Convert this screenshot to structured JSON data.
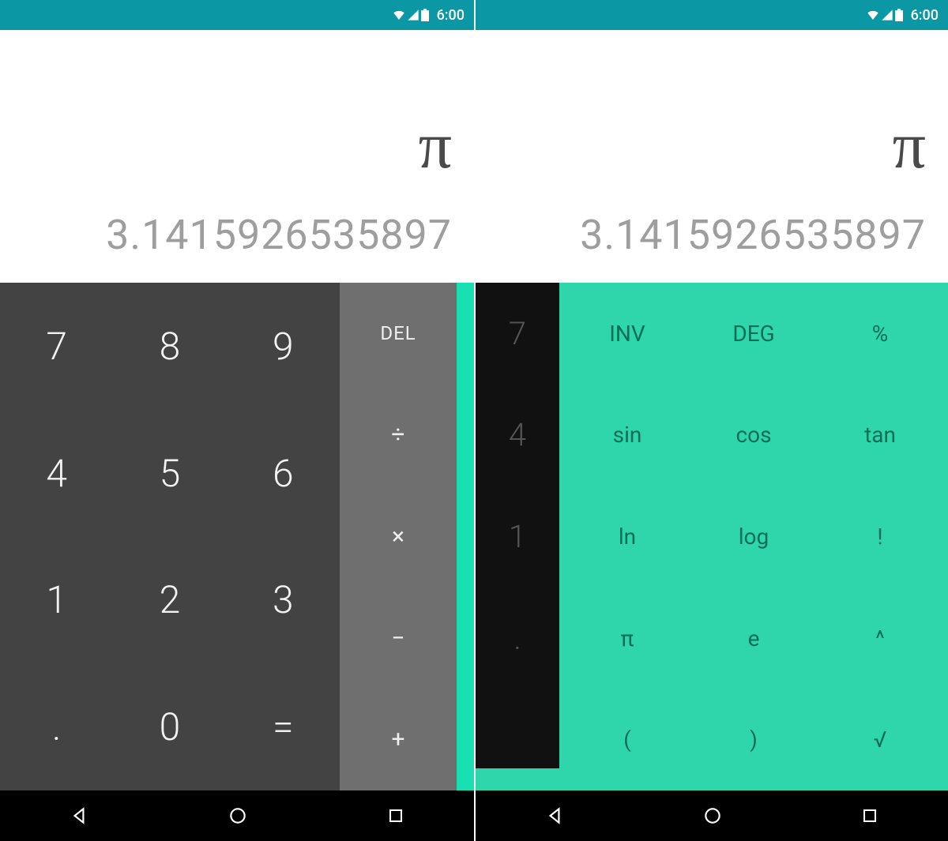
{
  "status": {
    "time": "6:00"
  },
  "display": {
    "expression": "π",
    "result": "3.1415926535897"
  },
  "left": {
    "numpad": [
      "7",
      "8",
      "9",
      "4",
      "5",
      "6",
      "1",
      "2",
      "3",
      ".",
      "0",
      "="
    ],
    "ops": {
      "del": "DEL",
      "div": "÷",
      "mul": "×",
      "sub": "−",
      "add": "+"
    }
  },
  "right": {
    "strip": [
      "7",
      "4",
      "1",
      ".",
      ""
    ],
    "adv": [
      "INV",
      "DEG",
      "%",
      "sin",
      "cos",
      "tan",
      "ln",
      "log",
      "!",
      "π",
      "e",
      "^",
      "(",
      ")",
      "√"
    ]
  }
}
